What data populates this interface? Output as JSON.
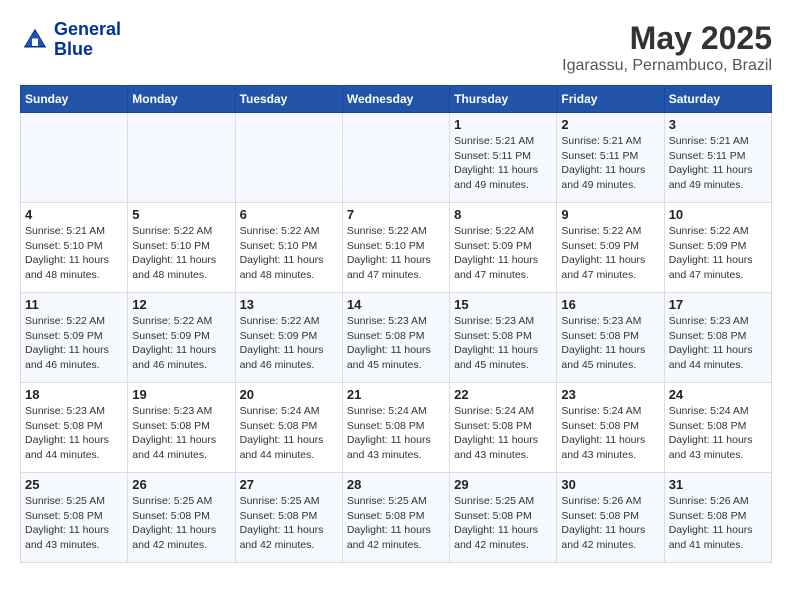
{
  "logo": {
    "line1": "General",
    "line2": "Blue"
  },
  "title": "May 2025",
  "subtitle": "Igarassu, Pernambuco, Brazil",
  "days_of_week": [
    "Sunday",
    "Monday",
    "Tuesday",
    "Wednesday",
    "Thursday",
    "Friday",
    "Saturday"
  ],
  "weeks": [
    [
      {
        "day": "",
        "info": ""
      },
      {
        "day": "",
        "info": ""
      },
      {
        "day": "",
        "info": ""
      },
      {
        "day": "",
        "info": ""
      },
      {
        "day": "1",
        "info": "Sunrise: 5:21 AM\nSunset: 5:11 PM\nDaylight: 11 hours\nand 49 minutes."
      },
      {
        "day": "2",
        "info": "Sunrise: 5:21 AM\nSunset: 5:11 PM\nDaylight: 11 hours\nand 49 minutes."
      },
      {
        "day": "3",
        "info": "Sunrise: 5:21 AM\nSunset: 5:11 PM\nDaylight: 11 hours\nand 49 minutes."
      }
    ],
    [
      {
        "day": "4",
        "info": "Sunrise: 5:21 AM\nSunset: 5:10 PM\nDaylight: 11 hours\nand 48 minutes."
      },
      {
        "day": "5",
        "info": "Sunrise: 5:22 AM\nSunset: 5:10 PM\nDaylight: 11 hours\nand 48 minutes."
      },
      {
        "day": "6",
        "info": "Sunrise: 5:22 AM\nSunset: 5:10 PM\nDaylight: 11 hours\nand 48 minutes."
      },
      {
        "day": "7",
        "info": "Sunrise: 5:22 AM\nSunset: 5:10 PM\nDaylight: 11 hours\nand 47 minutes."
      },
      {
        "day": "8",
        "info": "Sunrise: 5:22 AM\nSunset: 5:09 PM\nDaylight: 11 hours\nand 47 minutes."
      },
      {
        "day": "9",
        "info": "Sunrise: 5:22 AM\nSunset: 5:09 PM\nDaylight: 11 hours\nand 47 minutes."
      },
      {
        "day": "10",
        "info": "Sunrise: 5:22 AM\nSunset: 5:09 PM\nDaylight: 11 hours\nand 47 minutes."
      }
    ],
    [
      {
        "day": "11",
        "info": "Sunrise: 5:22 AM\nSunset: 5:09 PM\nDaylight: 11 hours\nand 46 minutes."
      },
      {
        "day": "12",
        "info": "Sunrise: 5:22 AM\nSunset: 5:09 PM\nDaylight: 11 hours\nand 46 minutes."
      },
      {
        "day": "13",
        "info": "Sunrise: 5:22 AM\nSunset: 5:09 PM\nDaylight: 11 hours\nand 46 minutes."
      },
      {
        "day": "14",
        "info": "Sunrise: 5:23 AM\nSunset: 5:08 PM\nDaylight: 11 hours\nand 45 minutes."
      },
      {
        "day": "15",
        "info": "Sunrise: 5:23 AM\nSunset: 5:08 PM\nDaylight: 11 hours\nand 45 minutes."
      },
      {
        "day": "16",
        "info": "Sunrise: 5:23 AM\nSunset: 5:08 PM\nDaylight: 11 hours\nand 45 minutes."
      },
      {
        "day": "17",
        "info": "Sunrise: 5:23 AM\nSunset: 5:08 PM\nDaylight: 11 hours\nand 44 minutes."
      }
    ],
    [
      {
        "day": "18",
        "info": "Sunrise: 5:23 AM\nSunset: 5:08 PM\nDaylight: 11 hours\nand 44 minutes."
      },
      {
        "day": "19",
        "info": "Sunrise: 5:23 AM\nSunset: 5:08 PM\nDaylight: 11 hours\nand 44 minutes."
      },
      {
        "day": "20",
        "info": "Sunrise: 5:24 AM\nSunset: 5:08 PM\nDaylight: 11 hours\nand 44 minutes."
      },
      {
        "day": "21",
        "info": "Sunrise: 5:24 AM\nSunset: 5:08 PM\nDaylight: 11 hours\nand 43 minutes."
      },
      {
        "day": "22",
        "info": "Sunrise: 5:24 AM\nSunset: 5:08 PM\nDaylight: 11 hours\nand 43 minutes."
      },
      {
        "day": "23",
        "info": "Sunrise: 5:24 AM\nSunset: 5:08 PM\nDaylight: 11 hours\nand 43 minutes."
      },
      {
        "day": "24",
        "info": "Sunrise: 5:24 AM\nSunset: 5:08 PM\nDaylight: 11 hours\nand 43 minutes."
      }
    ],
    [
      {
        "day": "25",
        "info": "Sunrise: 5:25 AM\nSunset: 5:08 PM\nDaylight: 11 hours\nand 43 minutes."
      },
      {
        "day": "26",
        "info": "Sunrise: 5:25 AM\nSunset: 5:08 PM\nDaylight: 11 hours\nand 42 minutes."
      },
      {
        "day": "27",
        "info": "Sunrise: 5:25 AM\nSunset: 5:08 PM\nDaylight: 11 hours\nand 42 minutes."
      },
      {
        "day": "28",
        "info": "Sunrise: 5:25 AM\nSunset: 5:08 PM\nDaylight: 11 hours\nand 42 minutes."
      },
      {
        "day": "29",
        "info": "Sunrise: 5:25 AM\nSunset: 5:08 PM\nDaylight: 11 hours\nand 42 minutes."
      },
      {
        "day": "30",
        "info": "Sunrise: 5:26 AM\nSunset: 5:08 PM\nDaylight: 11 hours\nand 42 minutes."
      },
      {
        "day": "31",
        "info": "Sunrise: 5:26 AM\nSunset: 5:08 PM\nDaylight: 11 hours\nand 41 minutes."
      }
    ]
  ]
}
